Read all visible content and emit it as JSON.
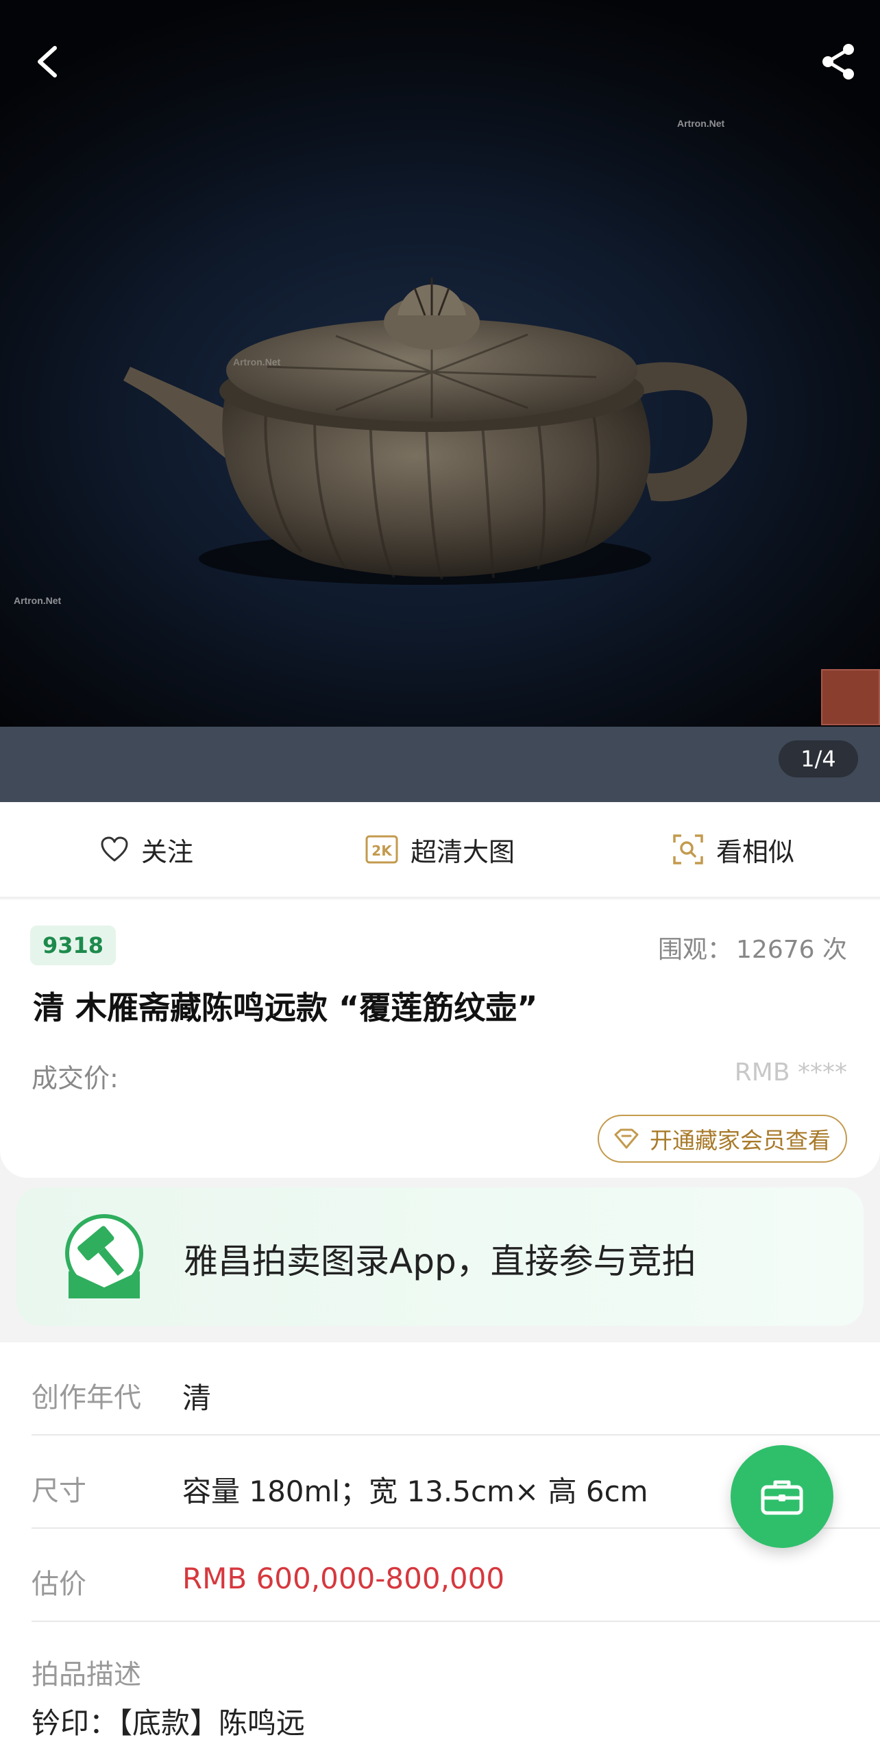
{
  "gallery": {
    "counter": "1/4",
    "watermark": "Artron.Net"
  },
  "actions": {
    "follow": "关注",
    "hd": "超清大图",
    "hd_icon_text": "2K",
    "similar": "看相似"
  },
  "lot": {
    "number": "9318",
    "views_label": "围观：",
    "views_count": "12676 次",
    "title": "清 木雁斋藏陈鸣远款 “覆莲筋纹壶”",
    "price_label": "成交价:",
    "price_masked": "RMB ****",
    "vip_button": "开通藏家会员查看"
  },
  "promo": {
    "text": "雅昌拍卖图录App，直接参与竞拍"
  },
  "details": {
    "rows": [
      {
        "label": "创作年代",
        "value": "清"
      },
      {
        "label": "尺寸",
        "value": "容量 180ml；宽 13.5cm× 高 6cm"
      },
      {
        "label": "估价",
        "value": "RMB  600,000-800,000"
      }
    ],
    "desc_title": "拍品描述",
    "desc_body": "钤印：【底款】陈鸣远"
  },
  "colors": {
    "accent_green": "#2fbf6b",
    "estimate_red": "#d6383e",
    "vip_gold": "#c39a4e"
  }
}
